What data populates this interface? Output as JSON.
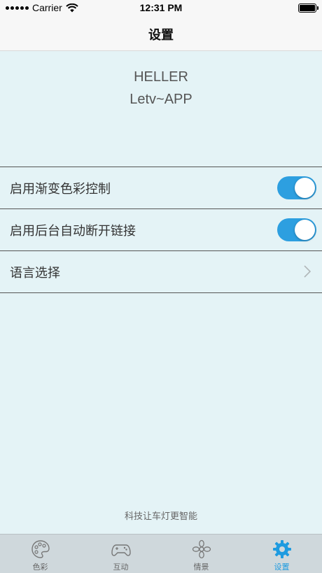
{
  "status_bar": {
    "carrier": "Carrier",
    "time": "12:31 PM"
  },
  "nav": {
    "title": "设置"
  },
  "header": {
    "brand": "HELLER",
    "app": "Letv~APP"
  },
  "settings": {
    "items": [
      {
        "label": "启用渐变色彩控制",
        "type": "toggle",
        "on": true
      },
      {
        "label": "启用后台自动断开链接",
        "type": "toggle",
        "on": true
      },
      {
        "label": "语言选择",
        "type": "disclosure"
      }
    ]
  },
  "footer": {
    "slogan": "科技让车灯更智能"
  },
  "tab_bar": {
    "tabs": [
      {
        "label": "色彩",
        "icon": "palette-icon",
        "active": false
      },
      {
        "label": "互动",
        "icon": "gamepad-icon",
        "active": false
      },
      {
        "label": "情景",
        "icon": "flower-icon",
        "active": false
      },
      {
        "label": "设置",
        "icon": "gear-icon",
        "active": true
      }
    ]
  },
  "colors": {
    "accent": "#2d9fe0",
    "background": "#e4f3f6",
    "tab_bar": "#cfd8dc"
  }
}
